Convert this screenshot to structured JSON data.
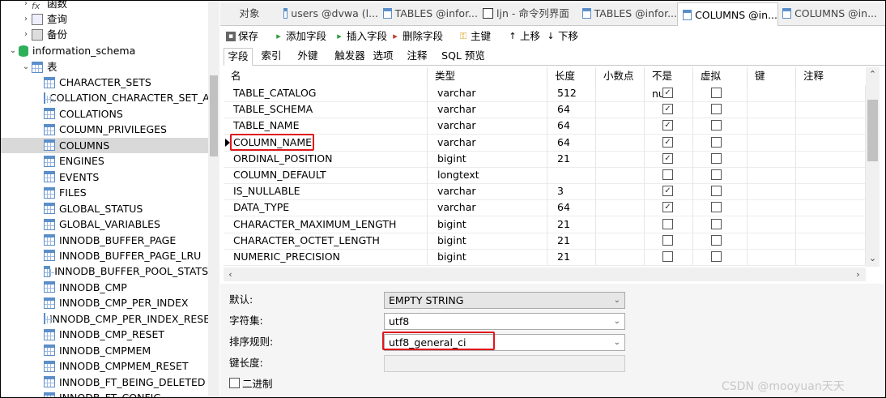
{
  "tree": {
    "top_items": [
      {
        "label": "函数",
        "icon": "function-icon"
      },
      {
        "label": "查询",
        "icon": "query-icon"
      },
      {
        "label": "备份",
        "icon": "backup-icon"
      }
    ],
    "schema": "information_schema",
    "tables_group": "表",
    "tables": [
      "CHARACTER_SETS",
      "COLLATION_CHARACTER_SET_A",
      "COLLATIONS",
      "COLUMN_PRIVILEGES",
      "COLUMNS",
      "ENGINES",
      "EVENTS",
      "FILES",
      "GLOBAL_STATUS",
      "GLOBAL_VARIABLES",
      "INNODB_BUFFER_PAGE",
      "INNODB_BUFFER_PAGE_LRU",
      "INNODB_BUFFER_POOL_STATS",
      "INNODB_CMP",
      "INNODB_CMP_PER_INDEX",
      "INNODB_CMP_PER_INDEX_RESE",
      "INNODB_CMP_RESET",
      "INNODB_CMPMEM",
      "INNODB_CMPMEM_RESET",
      "INNODB_FT_BEING_DELETED",
      "INNODB_FT_CONFIG"
    ],
    "selected": "COLUMNS"
  },
  "tabs": [
    "对象",
    "users @dvwa (l...",
    "TABLES @infor...",
    "ljn - 命令列界面",
    "TABLES @infor...",
    "COLUMNS @in...",
    "COLUMNS @in..."
  ],
  "active_tab": 5,
  "toolbar": {
    "save": "保存",
    "add_field": "添加字段",
    "insert_field": "插入字段",
    "delete_field": "删除字段",
    "primary_key": "主键",
    "move_up": "上移",
    "move_down": "下移"
  },
  "subtabs": [
    "字段",
    "索引",
    "外键",
    "触发器",
    "选项",
    "注释",
    "SQL 预览"
  ],
  "grid": {
    "headers": [
      "名",
      "类型",
      "长度",
      "小数点",
      "不是 null",
      "虚拟",
      "键",
      "注释"
    ],
    "rows": [
      {
        "name": "TABLE_CATALOG",
        "type": "varchar",
        "length": "512",
        "not_null": true,
        "virtual": false
      },
      {
        "name": "TABLE_SCHEMA",
        "type": "varchar",
        "length": "64",
        "not_null": true,
        "virtual": false
      },
      {
        "name": "TABLE_NAME",
        "type": "varchar",
        "length": "64",
        "not_null": true,
        "virtual": false
      },
      {
        "name": "COLUMN_NAME",
        "type": "varchar",
        "length": "64",
        "not_null": true,
        "virtual": false
      },
      {
        "name": "ORDINAL_POSITION",
        "type": "bigint",
        "length": "21",
        "not_null": true,
        "virtual": false
      },
      {
        "name": "COLUMN_DEFAULT",
        "type": "longtext",
        "length": "",
        "not_null": false,
        "virtual": false
      },
      {
        "name": "IS_NULLABLE",
        "type": "varchar",
        "length": "3",
        "not_null": true,
        "virtual": false
      },
      {
        "name": "DATA_TYPE",
        "type": "varchar",
        "length": "64",
        "not_null": true,
        "virtual": false
      },
      {
        "name": "CHARACTER_MAXIMUM_LENGTH",
        "type": "bigint",
        "length": "21",
        "not_null": false,
        "virtual": false
      },
      {
        "name": "CHARACTER_OCTET_LENGTH",
        "type": "bigint",
        "length": "21",
        "not_null": false,
        "virtual": false
      },
      {
        "name": "NUMERIC_PRECISION",
        "type": "bigint",
        "length": "21",
        "not_null": false,
        "virtual": false
      }
    ],
    "current_row": 3
  },
  "props": {
    "default_label": "默认:",
    "default_value": "EMPTY STRING",
    "charset_label": "字符集:",
    "charset_value": "utf8",
    "collation_label": "排序规则:",
    "collation_value": "utf8_general_ci",
    "key_length_label": "键长度:",
    "key_length_value": "",
    "binary_label": "二进制"
  },
  "watermark": "CSDN @mooyuan天天",
  "colors": {
    "highlight": "#e0161b",
    "selected_row": "#d9d9d9",
    "accent": "#5b8ec9"
  }
}
